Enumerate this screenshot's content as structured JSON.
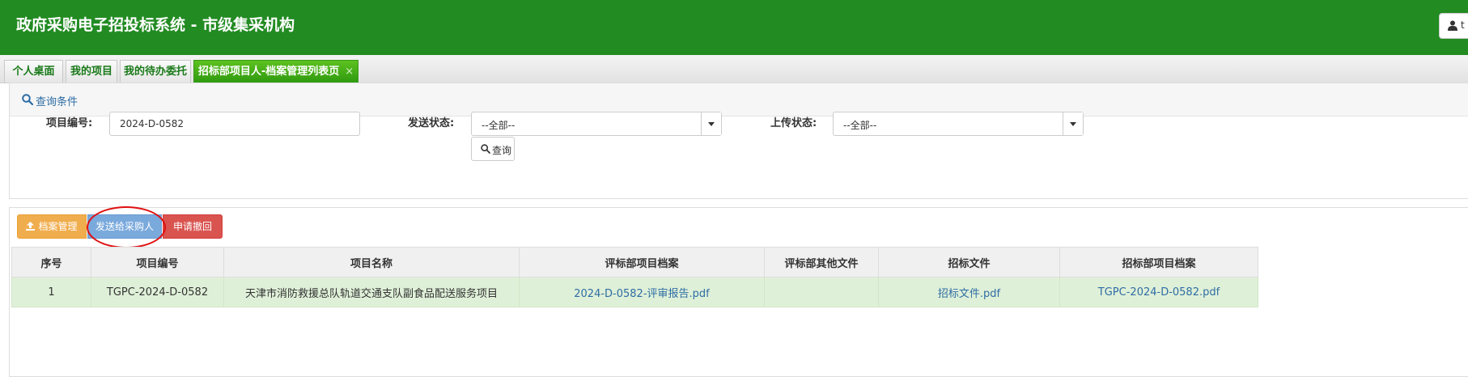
{
  "header": {
    "title": "政府采购电子招投标系统 - 市级集采机构",
    "user_button_label": "t"
  },
  "tabs": [
    {
      "label": "个人桌面"
    },
    {
      "label": "我的项目"
    },
    {
      "label": "我的待办委托"
    },
    {
      "label": "招标部项目人-档案管理列表页",
      "active": true,
      "close": "×"
    }
  ],
  "query": {
    "title": "查询条件",
    "project_no_label": "项目编号:",
    "project_no_value": "2024-D-0582",
    "send_status_label": "发送状态:",
    "send_status_value": "--全部--",
    "upload_status_label": "上传状态:",
    "upload_status_value": "--全部--",
    "search_button": "查询"
  },
  "toolbar": {
    "archive_button": "档案管理",
    "send_button": "发送给采购人",
    "revoke_button": "申请撤回"
  },
  "table": {
    "headers": [
      "序号",
      "项目编号",
      "项目名称",
      "评标部项目档案",
      "评标部其他文件",
      "招标文件",
      "招标部项目档案"
    ],
    "rows": [
      {
        "index": "1",
        "project_no": "TGPC-2024-D-0582",
        "project_name": "天津市消防救援总队轨道交通支队副食品配送服务项目",
        "eval_archive": "2024-D-0582-评审报告.pdf",
        "eval_other": "",
        "tender_file": "招标文件.pdf",
        "tender_archive": "TGPC-2024-D-0582.pdf"
      }
    ]
  },
  "colors": {
    "header_bg": "#228B22",
    "active_tab": "#3fa51a",
    "archive_btn": "#f0ad4e",
    "send_btn": "#7aa9dc",
    "revoke_btn": "#d9534f",
    "row_highlight": "#dff0d8",
    "annotation_circle": "#e01010"
  },
  "icons": [
    "user-icon",
    "search-icon",
    "upload-icon"
  ]
}
